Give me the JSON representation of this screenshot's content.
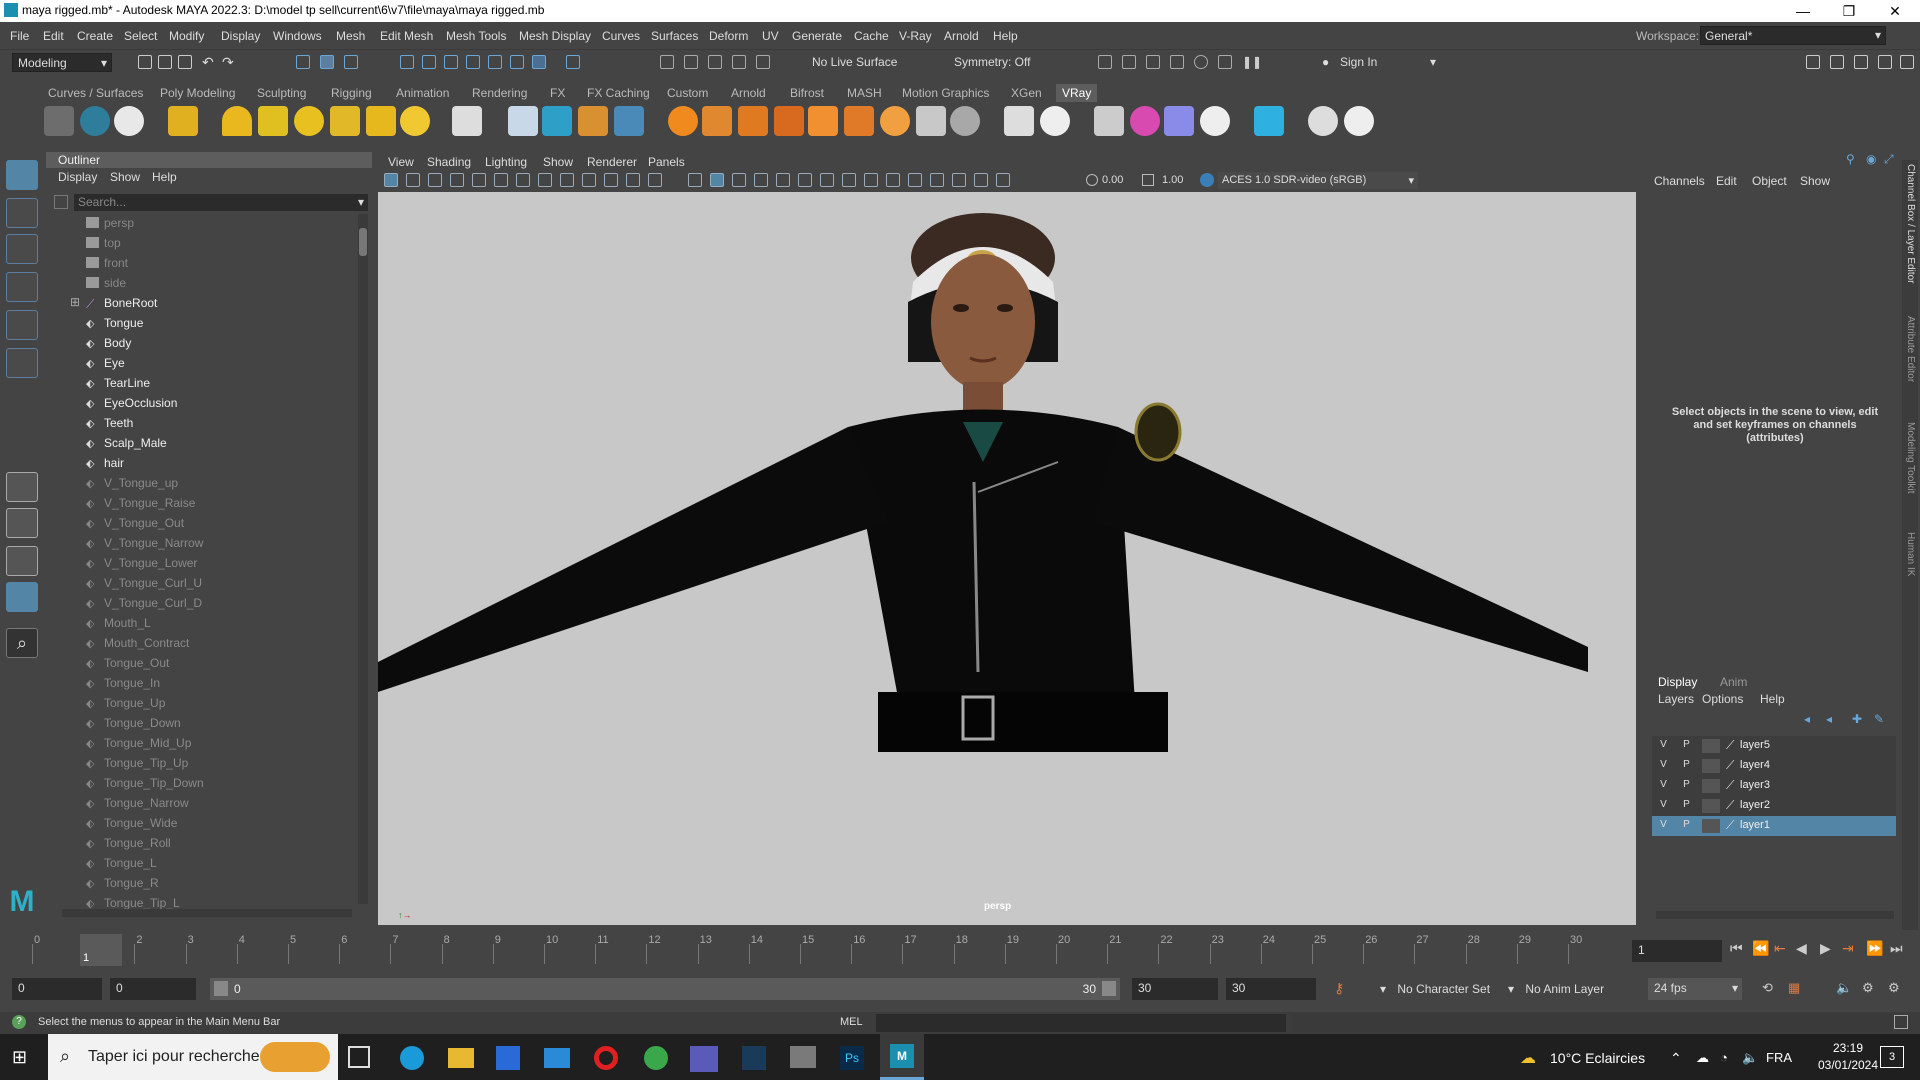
{
  "window": {
    "title": "maya rigged.mb* - Autodesk MAYA 2022.3: D:\\model tp sell\\current\\6\\v7\\file\\maya\\maya rigged.mb",
    "minimize": "—",
    "maximize": "❐",
    "close": "✕"
  },
  "menu": [
    "File",
    "Edit",
    "Create",
    "Select",
    "Modify",
    "Display",
    "Windows",
    "Mesh",
    "Edit Mesh",
    "Mesh Tools",
    "Mesh Display",
    "Curves",
    "Surfaces",
    "Deform",
    "UV",
    "Generate",
    "Cache",
    "V-Ray",
    "Arnold",
    "Help"
  ],
  "workspace": {
    "label": "Workspace:",
    "value": "General*"
  },
  "statusline": {
    "mode": "Modeling",
    "live_surface": "No Live Surface",
    "symmetry": "Symmetry: Off",
    "sign_in": "Sign In"
  },
  "shelf_tabs": [
    "Curves / Surfaces",
    "Poly Modeling",
    "Sculpting",
    "Rigging",
    "Animation",
    "Rendering",
    "FX",
    "FX Caching",
    "Custom",
    "Arnold",
    "Bifrost",
    "MASH",
    "Motion Graphics",
    "XGen",
    "VRay"
  ],
  "shelf_active": "VRay",
  "outliner": {
    "title": "Outliner",
    "menu": [
      "Display",
      "Show",
      "Help"
    ],
    "search_placeholder": "Search...",
    "items": [
      {
        "label": "persp",
        "kind": "cam"
      },
      {
        "label": "top",
        "kind": "cam"
      },
      {
        "label": "front",
        "kind": "cam"
      },
      {
        "label": "side",
        "kind": "cam"
      },
      {
        "label": "BoneRoot",
        "kind": "bone"
      },
      {
        "label": "Tongue",
        "kind": "mesh"
      },
      {
        "label": "Body",
        "kind": "mesh"
      },
      {
        "label": "Eye",
        "kind": "mesh"
      },
      {
        "label": "TearLine",
        "kind": "mesh"
      },
      {
        "label": "EyeOcclusion",
        "kind": "mesh"
      },
      {
        "label": "Teeth",
        "kind": "mesh"
      },
      {
        "label": "Scalp_Male",
        "kind": "mesh"
      },
      {
        "label": "hair",
        "kind": "mesh"
      },
      {
        "label": "V_Tongue_up",
        "kind": "blend"
      },
      {
        "label": "V_Tongue_Raise",
        "kind": "blend"
      },
      {
        "label": "V_Tongue_Out",
        "kind": "blend"
      },
      {
        "label": "V_Tongue_Narrow",
        "kind": "blend"
      },
      {
        "label": "V_Tongue_Lower",
        "kind": "blend"
      },
      {
        "label": "V_Tongue_Curl_U",
        "kind": "blend"
      },
      {
        "label": "V_Tongue_Curl_D",
        "kind": "blend"
      },
      {
        "label": "Mouth_L",
        "kind": "blend"
      },
      {
        "label": "Mouth_Contract",
        "kind": "blend"
      },
      {
        "label": "Tongue_Out",
        "kind": "blend"
      },
      {
        "label": "Tongue_In",
        "kind": "blend"
      },
      {
        "label": "Tongue_Up",
        "kind": "blend"
      },
      {
        "label": "Tongue_Down",
        "kind": "blend"
      },
      {
        "label": "Tongue_Mid_Up",
        "kind": "blend"
      },
      {
        "label": "Tongue_Tip_Up",
        "kind": "blend"
      },
      {
        "label": "Tongue_Tip_Down",
        "kind": "blend"
      },
      {
        "label": "Tongue_Narrow",
        "kind": "blend"
      },
      {
        "label": "Tongue_Wide",
        "kind": "blend"
      },
      {
        "label": "Tongue_Roll",
        "kind": "blend"
      },
      {
        "label": "Tongue_L",
        "kind": "blend"
      },
      {
        "label": "Tongue_R",
        "kind": "blend"
      },
      {
        "label": "Tongue_Tip_L",
        "kind": "blend"
      }
    ]
  },
  "viewport": {
    "menu": [
      "View",
      "Shading",
      "Lighting",
      "Show",
      "Renderer",
      "Panels"
    ],
    "exposure": "0.00",
    "gamma": "1.00",
    "color_space": "ACES 1.0 SDR-video (sRGB)",
    "camera": "persp"
  },
  "channelbox": {
    "menu": [
      "Channels",
      "Edit",
      "Object",
      "Show"
    ],
    "message": "Select objects in the scene to view, edit and set keyframes on channels (attributes)",
    "side_tabs": [
      "Channel Box / Layer Editor",
      "Attribute Editor",
      "Modeling Toolkit",
      "Human IK"
    ]
  },
  "layers": {
    "tabs": [
      "Display",
      "Anim"
    ],
    "menu": [
      "Layers",
      "Options",
      "Help"
    ],
    "items": [
      {
        "name": "layer5",
        "v": "V",
        "p": "P",
        "selected": false
      },
      {
        "name": "layer4",
        "v": "V",
        "p": "P",
        "selected": false
      },
      {
        "name": "layer3",
        "v": "V",
        "p": "P",
        "selected": false
      },
      {
        "name": "layer2",
        "v": "V",
        "p": "P",
        "selected": false
      },
      {
        "name": "layer1",
        "v": "V",
        "p": "P",
        "selected": true
      }
    ]
  },
  "timeline": {
    "ticks": [
      "0",
      "1",
      "2",
      "3",
      "4",
      "5",
      "6",
      "7",
      "8",
      "9",
      "10",
      "11",
      "12",
      "13",
      "14",
      "15",
      "16",
      "17",
      "18",
      "19",
      "20",
      "21",
      "22",
      "23",
      "24",
      "25",
      "26",
      "27",
      "28",
      "29",
      "30"
    ],
    "current_frame": "1",
    "current_frame_field": "1"
  },
  "range": {
    "start": "0",
    "anim_start": "0",
    "slider_start": "0",
    "slider_end": "30",
    "anim_end": "30",
    "end": "30",
    "character_set": "No Character Set",
    "anim_layer": "No Anim Layer",
    "fps": "24 fps"
  },
  "commandline": {
    "help": "Select the menus to appear in the Main Menu Bar",
    "lang": "MEL"
  },
  "taskbar": {
    "search_placeholder": "Taper ici pour rechercher",
    "weather": "10°C Eclaircies",
    "lang": "FRA",
    "time": "23:19",
    "date": "03/01/2024",
    "notifications": "3"
  }
}
